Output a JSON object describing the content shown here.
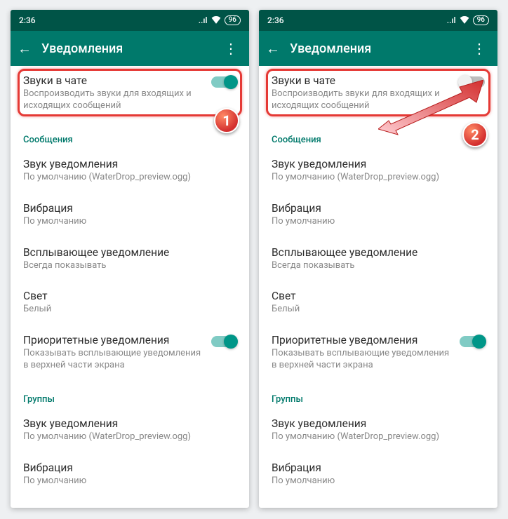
{
  "status": {
    "time": "2:36",
    "battery": "96"
  },
  "appbar": {
    "title": "Уведомления"
  },
  "chat_sounds": {
    "title": "Звуки в чате",
    "subtitle": "Воспроизводить звуки для входящих и исходящих сообщений"
  },
  "sections": {
    "messages": {
      "label": "Сообщения",
      "notif_sound": {
        "title": "Звук уведомления",
        "subtitle": "По умолчанию (WaterDrop_preview.ogg)"
      },
      "vibration": {
        "title": "Вибрация",
        "subtitle": "По умолчанию"
      },
      "popup": {
        "title": "Всплывающее уведомление",
        "subtitle": "Всегда показывать"
      },
      "light": {
        "title": "Свет",
        "subtitle": "Белый"
      },
      "priority": {
        "title": "Приоритетные уведомления",
        "subtitle": "Показывать всплывающие уведомления в верхней части экрана"
      }
    },
    "groups": {
      "label": "Группы",
      "notif_sound": {
        "title": "Звук уведомления",
        "subtitle": "По умолчанию (WaterDrop_preview.ogg)"
      },
      "vibration": {
        "title": "Вибрация",
        "subtitle": "По умолчанию"
      }
    }
  },
  "annotations": {
    "step1": "1",
    "step2": "2"
  }
}
